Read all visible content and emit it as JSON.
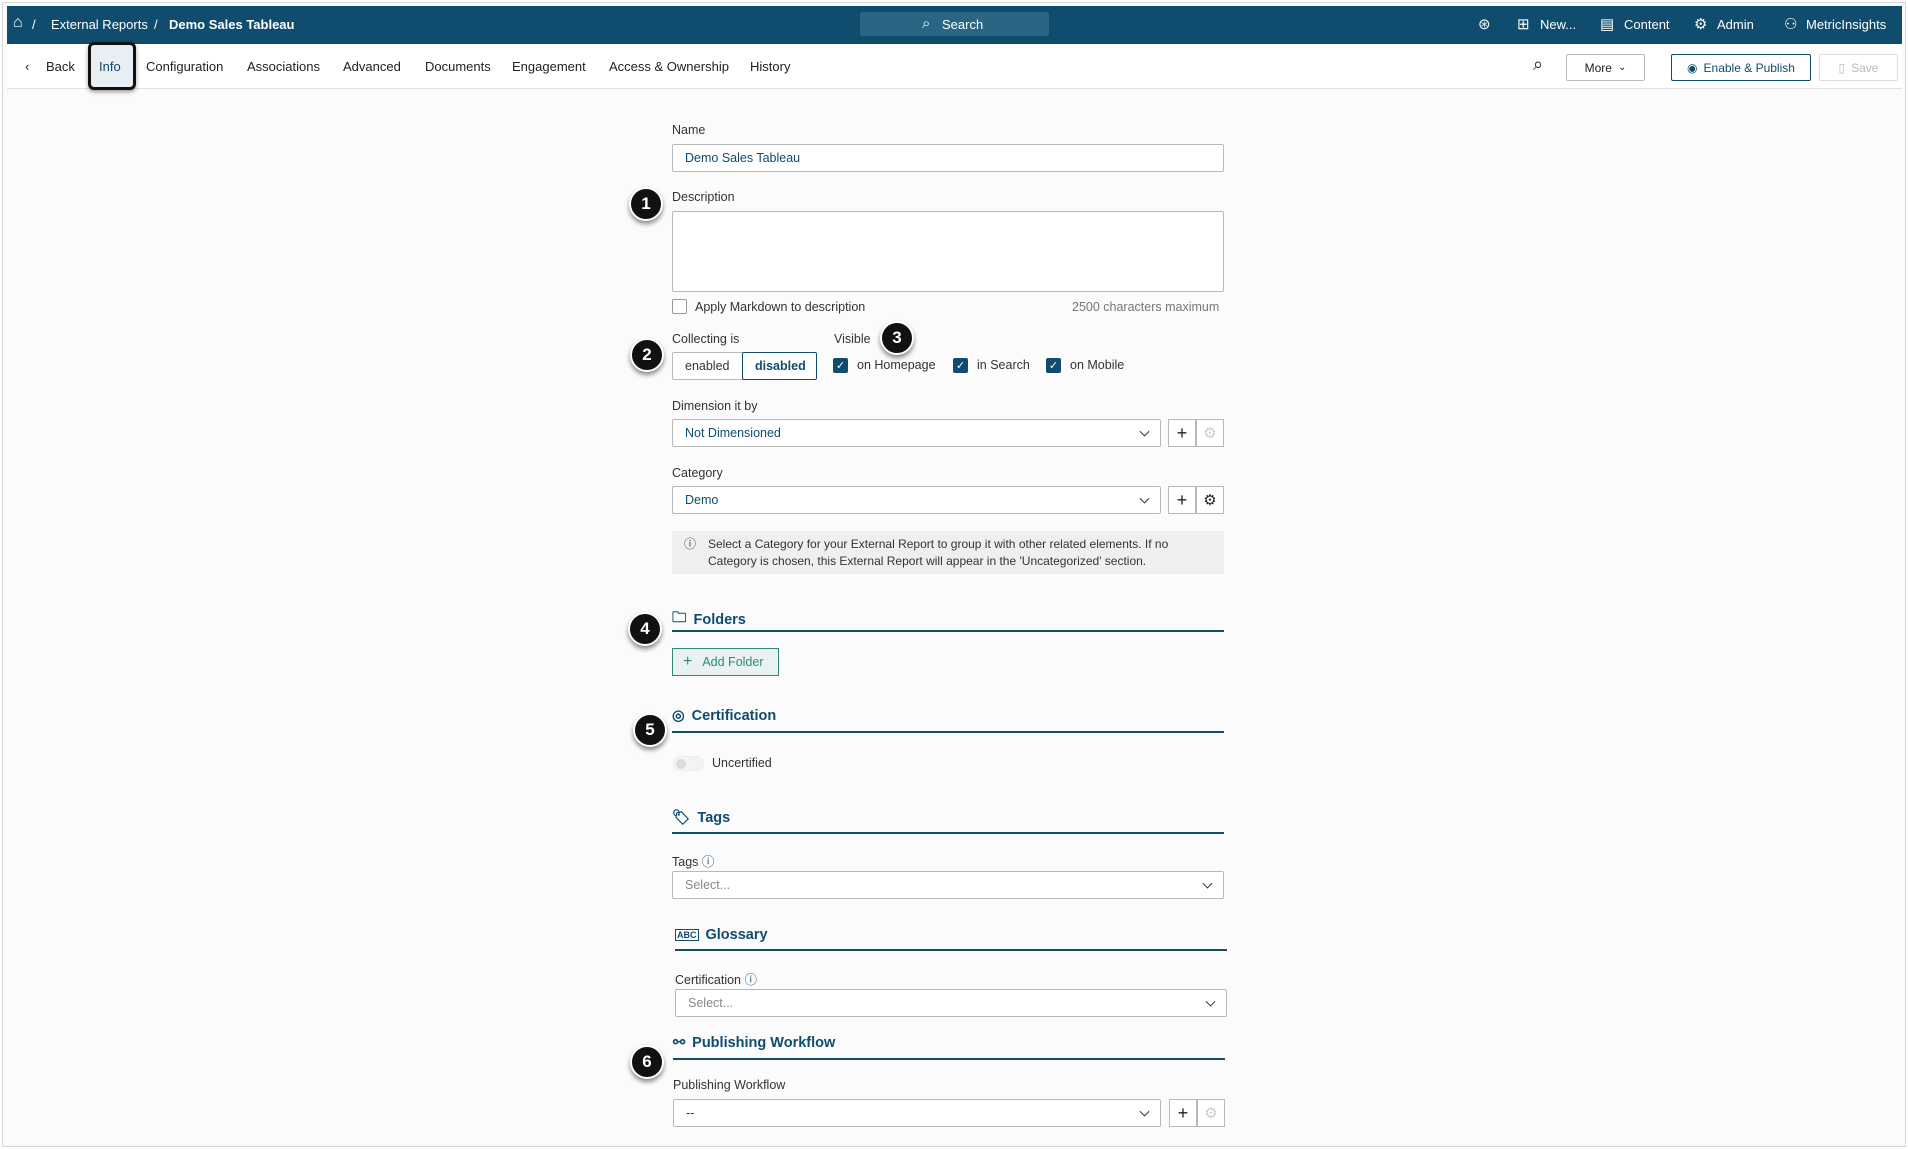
{
  "header": {
    "breadcrumb": [
      "External Reports",
      "Demo Sales Tableau"
    ],
    "search_label": "Search",
    "new_label": "New...",
    "content_label": "Content",
    "admin_label": "Admin",
    "user_label": "MetricInsights"
  },
  "tabs": {
    "back": "Back",
    "items": [
      "Info",
      "Configuration",
      "Associations",
      "Advanced",
      "Documents",
      "Engagement",
      "Access & Ownership",
      "History"
    ],
    "more": "More",
    "enable_publish": "Enable & Publish",
    "save": "Save"
  },
  "form": {
    "name_label": "Name",
    "name_value": "Demo Sales Tableau",
    "description_label": "Description",
    "markdown_label": "Apply Markdown to description",
    "char_limit": "2500 characters maximum",
    "collecting_label": "Collecting is",
    "collecting_options": [
      "enabled",
      "disabled"
    ],
    "collecting_selected": "disabled",
    "visible_label": "Visible",
    "visible_options": [
      "on Homepage",
      "in Search",
      "on Mobile"
    ],
    "dimension_label": "Dimension it by",
    "dimension_value": "Not Dimensioned",
    "category_label": "Category",
    "category_value": "Demo",
    "category_info": "Select a Category for your External Report to group it with other related elements. If no Category is chosen, this External Report will appear in the 'Uncategorized' section.",
    "folders_heading": "Folders",
    "add_folder": "Add Folder",
    "certification_heading": "Certification",
    "certification_status": "Uncertified",
    "tags_heading": "Tags",
    "tags_label": "Tags",
    "tags_placeholder": "Select...",
    "glossary_heading": "Glossary",
    "glossary_cert_label": "Certification",
    "glossary_placeholder": "Select...",
    "workflow_heading": "Publishing Workflow",
    "workflow_label": "Publishing Workflow",
    "workflow_value": "--"
  },
  "callouts": [
    "1",
    "2",
    "3",
    "4",
    "5",
    "6"
  ],
  "colors": {
    "brand": "#0f4c6e"
  }
}
